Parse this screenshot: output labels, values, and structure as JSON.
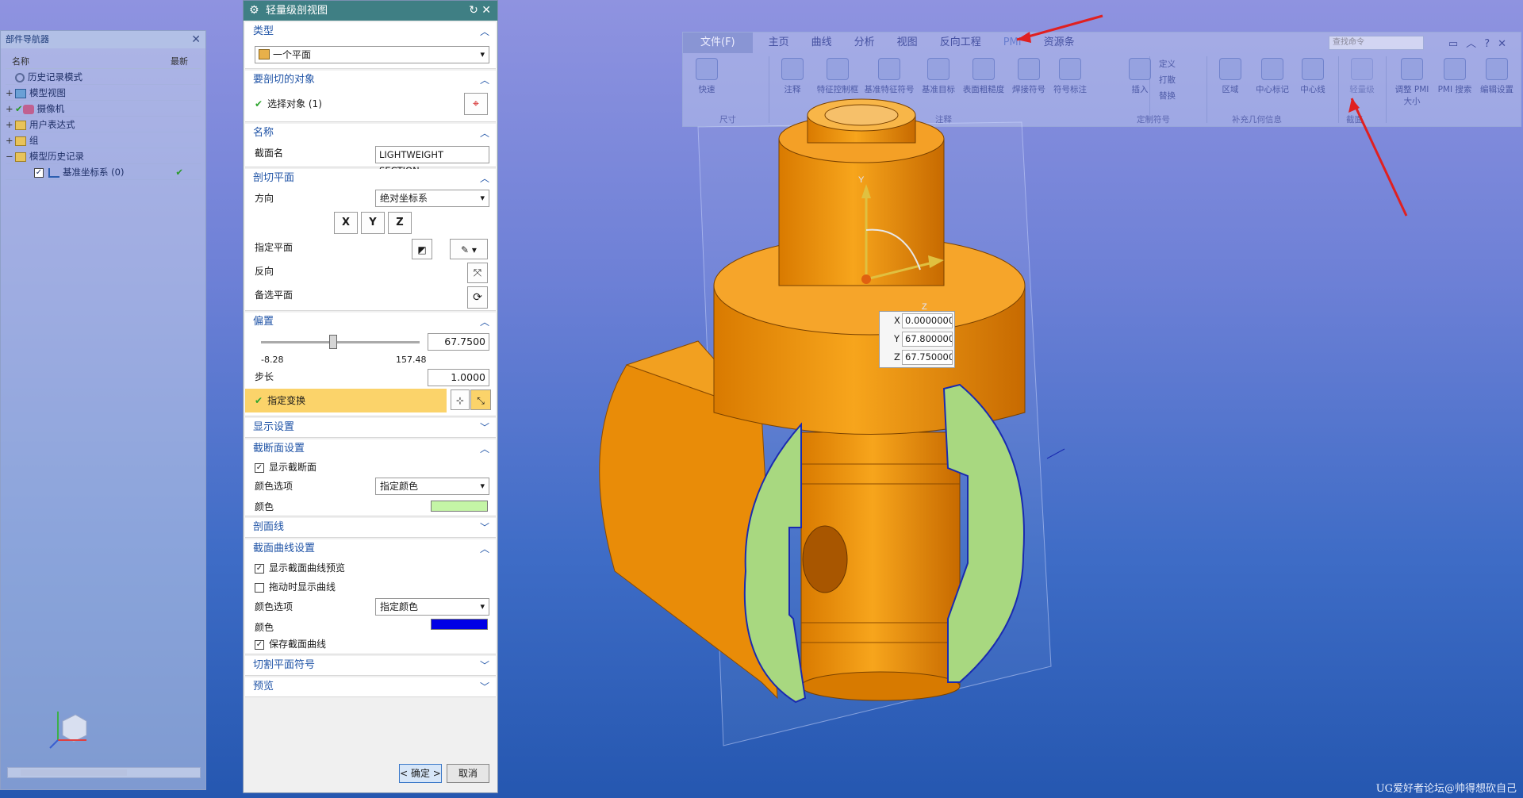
{
  "navigator": {
    "title": "部件导航器",
    "col_name": "名称",
    "col_latest": "最新",
    "items": [
      {
        "label": "历史记录模式",
        "pm": ""
      },
      {
        "label": "模型视图",
        "pm": "+"
      },
      {
        "label": "摄像机",
        "pm": "+"
      },
      {
        "label": "用户表达式",
        "pm": "+"
      },
      {
        "label": "组",
        "pm": "+"
      },
      {
        "label": "模型历史记录",
        "pm": "−"
      },
      {
        "label": "基准坐标系 (0)",
        "pm": ""
      }
    ]
  },
  "dialog": {
    "title": "轻量级剖视图",
    "type_section": "类型",
    "type_value": "一个平面",
    "objects_section": "要剖切的对象",
    "select_objects": "选择对象 (1)",
    "name_section": "名称",
    "section_name_label": "截面名",
    "section_name_value": "LIGHTWEIGHT SECTION",
    "cut_plane_section": "剖切平面",
    "direction_label": "方向",
    "direction_value": "绝对坐标系",
    "axis_x": "X",
    "axis_y": "Y",
    "axis_z": "Z",
    "specify_plane": "指定平面",
    "reverse": "反向",
    "alt_plane": "备选平面",
    "offset_section": "偏置",
    "offset_value": "67.7500",
    "slider_min": "-8.28",
    "slider_max": "157.48",
    "slider_fraction": 0.457,
    "step_label": "步长",
    "step_value": "1.0000",
    "specify_transform": "指定变换",
    "display_settings": "显示设置",
    "section_face_settings": "截断面设置",
    "show_section_face": "显示截断面",
    "color_option_label": "颜色选项",
    "color_option_value": "指定颜色",
    "color_label": "颜色",
    "face_color": "#c4f5a6",
    "hatch_section": "剖面线",
    "curve_settings": "截面曲线设置",
    "show_curve_preview": "显示截面曲线预览",
    "show_curve_drag": "拖动时显示曲线",
    "curve_color_option_value": "指定颜色",
    "curve_color": "#0000e6",
    "keep_curves": "保存截面曲线",
    "plane_symbol": "切割平面符号",
    "preview": "预览",
    "ok": "< 确定 >",
    "cancel": "取消"
  },
  "ribbon": {
    "tabs": [
      "文件(F)",
      "主页",
      "曲线",
      "分析",
      "视图",
      "反向工程",
      "PMI",
      "资源条"
    ],
    "search_placeholder": "查找命令",
    "buttons": [
      "快速",
      "注释",
      "特征控制框",
      "基准特征符号",
      "基准目标",
      "表面粗糙度",
      "焊接符号",
      "符号标注",
      "插入",
      "区域",
      "中心标记",
      "中心线",
      "轻量级",
      "调整 PMI 大小",
      "PMI 搜索",
      "编辑设置"
    ],
    "small": [
      "定义",
      "打散",
      "替换"
    ],
    "groups": [
      "尺寸",
      "注释",
      "定制符号",
      "补充几何信息",
      "截面"
    ]
  },
  "coord_box": {
    "x_label": "X",
    "x": "0.0000000",
    "y_label": "Y",
    "y": "67.800000",
    "z_label": "Z",
    "z": "67.750000"
  },
  "watermark": "UG爱好者论坛@帅得想砍自己"
}
